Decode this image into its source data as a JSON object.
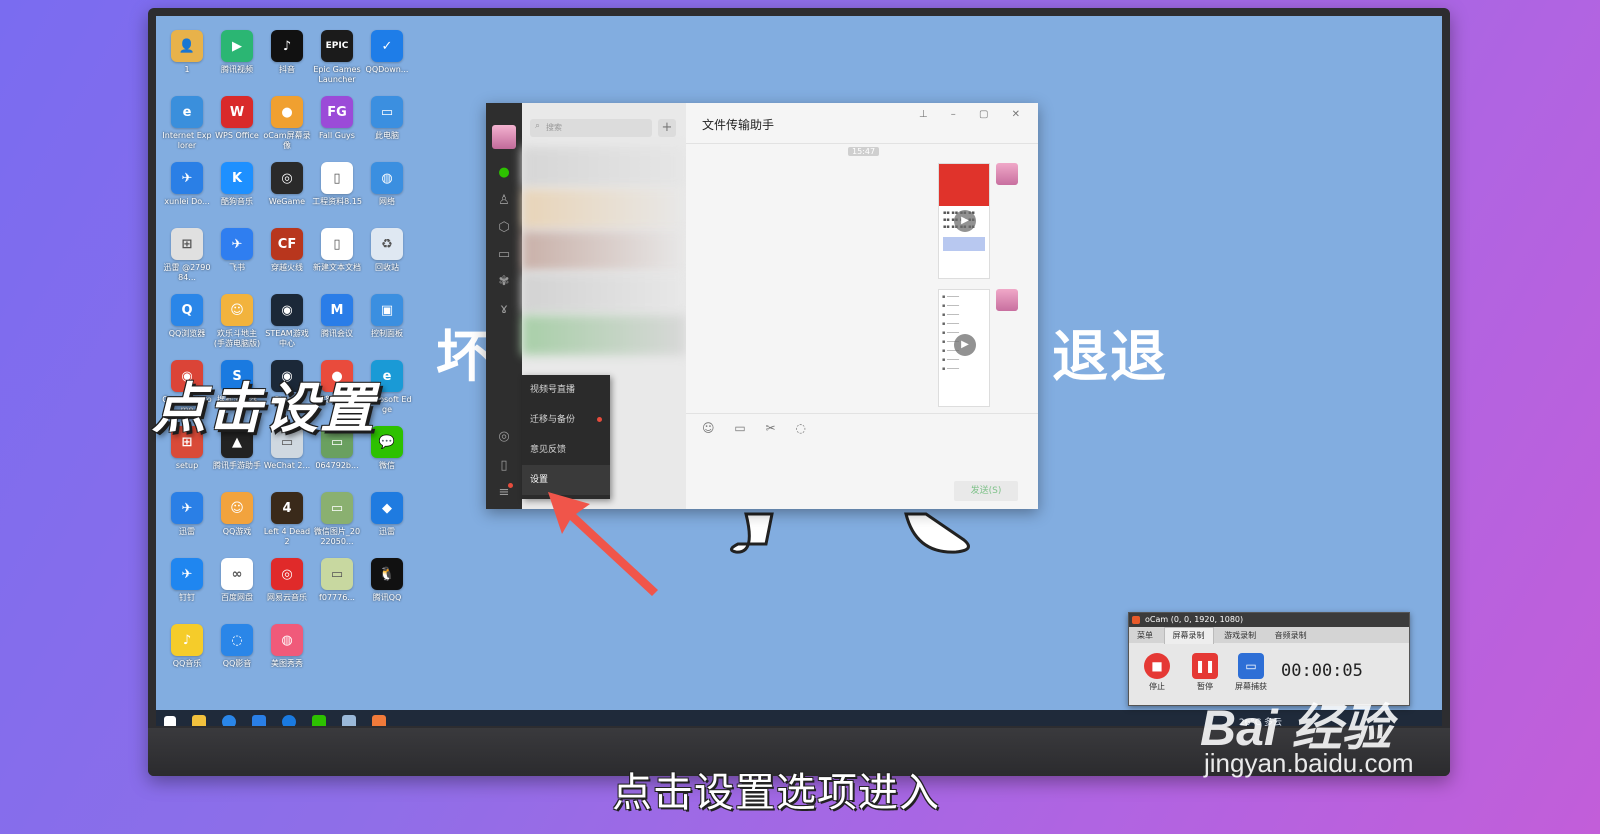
{
  "overlay": {
    "caption": "点击设置",
    "subtitle": "点击设置选项进入"
  },
  "desktop": {
    "background_text_left": "坏",
    "background_text_right": "退退",
    "icons": [
      {
        "label": "1",
        "color": "#e8b24a",
        "glyph": "👤"
      },
      {
        "label": "腾讯视频",
        "color": "#2bb673",
        "glyph": "▶"
      },
      {
        "label": "抖音",
        "color": "#111111",
        "glyph": "♪"
      },
      {
        "label": "Epic Games Launcher",
        "color": "#1b1b1b",
        "glyph": "EPIC"
      },
      {
        "label": "QQDown...",
        "color": "#1e7de8",
        "glyph": "✓"
      },
      {
        "label": "Internet Explorer",
        "color": "#3a8fdc",
        "glyph": "e"
      },
      {
        "label": "WPS Office",
        "color": "#d92a2a",
        "glyph": "W"
      },
      {
        "label": "oCam屏幕录像",
        "color": "#f0a030",
        "glyph": "●"
      },
      {
        "label": "Fall Guys",
        "color": "#9b4bd8",
        "glyph": "FG"
      },
      {
        "label": "此电脑",
        "color": "#3b8fe0",
        "glyph": "▭"
      },
      {
        "label": "xunlei Do...",
        "color": "#2a7fe6",
        "glyph": "✈"
      },
      {
        "label": "酷狗音乐",
        "color": "#1e90ff",
        "glyph": "K"
      },
      {
        "label": "WeGame",
        "color": "#2a2a2a",
        "glyph": "◎"
      },
      {
        "label": "工程资料8.15",
        "color": "#ffffff",
        "glyph": "▯"
      },
      {
        "label": "网络",
        "color": "#3b8fe0",
        "glyph": "◍"
      },
      {
        "label": "迅雷 @279084...",
        "color": "#e0e0e0",
        "glyph": "⊞"
      },
      {
        "label": "飞书",
        "color": "#2f7ef0",
        "glyph": "✈"
      },
      {
        "label": "穿越火线",
        "color": "#b8361d",
        "glyph": "CF"
      },
      {
        "label": "新建文本文档",
        "color": "#ffffff",
        "glyph": "▯"
      },
      {
        "label": "回收站",
        "color": "#dfe8f2",
        "glyph": "♻"
      },
      {
        "label": "QQ浏览器",
        "color": "#2a86e8",
        "glyph": "Q"
      },
      {
        "label": "欢乐斗地主(手游电脑版)",
        "color": "#f2b33d",
        "glyph": "☺"
      },
      {
        "label": "STEAM游戏中心",
        "color": "#1b2838",
        "glyph": "◉"
      },
      {
        "label": "腾讯会议",
        "color": "#2a7de8",
        "glyph": "M"
      },
      {
        "label": "控制面板",
        "color": "#3b8fe0",
        "glyph": "▣"
      },
      {
        "label": "Google Chrome",
        "color": "#db4437",
        "glyph": "◉"
      },
      {
        "label": "搜狗浏览器",
        "color": "#1a7ae0",
        "glyph": "S"
      },
      {
        "label": "Steam",
        "color": "#1b2838",
        "glyph": "◉"
      },
      {
        "label": "愤怒的小鸟",
        "color": "#e94b3c",
        "glyph": "●"
      },
      {
        "label": "Microsoft Edge",
        "color": "#1a9ad6",
        "glyph": "e"
      },
      {
        "label": "setup",
        "color": "#d94a38",
        "glyph": "⊞"
      },
      {
        "label": "腾讯手游助手",
        "color": "#222222",
        "glyph": "▲"
      },
      {
        "label": "WeChat 2...",
        "color": "#cfd8e0",
        "glyph": "▭"
      },
      {
        "label": "064792b...",
        "color": "#6aa060",
        "glyph": "▭"
      },
      {
        "label": "微信",
        "color": "#2dc100",
        "glyph": "💬"
      },
      {
        "label": "迅雷",
        "color": "#2a7fe6",
        "glyph": "✈"
      },
      {
        "label": "QQ游戏",
        "color": "#f2a33d",
        "glyph": "☺"
      },
      {
        "label": "Left 4 Dead 2",
        "color": "#3a2a1a",
        "glyph": "4"
      },
      {
        "label": "微信图片_2022050...",
        "color": "#8ab070",
        "glyph": "▭"
      },
      {
        "label": "迅雷",
        "color": "#1f7be0",
        "glyph": "◆"
      },
      {
        "label": "钉钉",
        "color": "#1f86f0",
        "glyph": "✈"
      },
      {
        "label": "百度网盘",
        "color": "#ffffff",
        "glyph": "∞"
      },
      {
        "label": "网易云音乐",
        "color": "#e02a2a",
        "glyph": "◎"
      },
      {
        "label": "f07776...",
        "color": "#c8d8a0",
        "glyph": "▭"
      },
      {
        "label": "腾讯QQ",
        "color": "#111111",
        "glyph": "🐧"
      },
      {
        "label": "QQ音乐",
        "color": "#f5cc2a",
        "glyph": "♪"
      },
      {
        "label": "QQ影音",
        "color": "#2a86e8",
        "glyph": "◌"
      },
      {
        "label": "美图秀秀",
        "color": "#f05a7a",
        "glyph": "◍"
      }
    ]
  },
  "wechat": {
    "search_placeholder": "搜索",
    "plus_label": "+",
    "chat_title": "文件传输助手",
    "time_label": "15:47",
    "send_label": "发送(S)",
    "window_controls": "⊥ – ▢ ✕",
    "tools": "☺ ▭ ✂ ◌",
    "menu": [
      {
        "label": "视频号直播",
        "dot": false
      },
      {
        "label": "迁移与备份",
        "dot": true
      },
      {
        "label": "意见反馈",
        "dot": false
      },
      {
        "label": "设置",
        "dot": false
      }
    ]
  },
  "ocam": {
    "title": "oCam (0, 0, 1920, 1080)",
    "tabs": [
      "菜单",
      "屏幕录制",
      "游戏录制",
      "音频录制"
    ],
    "active_tab": 1,
    "buttons": [
      {
        "label": "停止",
        "color": "#e53935",
        "glyph": "■"
      },
      {
        "label": "暂停",
        "color": "#e53935",
        "glyph": "❚❚"
      },
      {
        "label": "屏幕捕获",
        "color": "#2e6fd6",
        "glyph": "▭"
      }
    ],
    "timer": "00:00:05"
  },
  "taskbar": {
    "tray_text": "26°C 多云"
  },
  "watermark": {
    "logo": "Bai 经验",
    "url": "jingyan.baidu.com"
  }
}
